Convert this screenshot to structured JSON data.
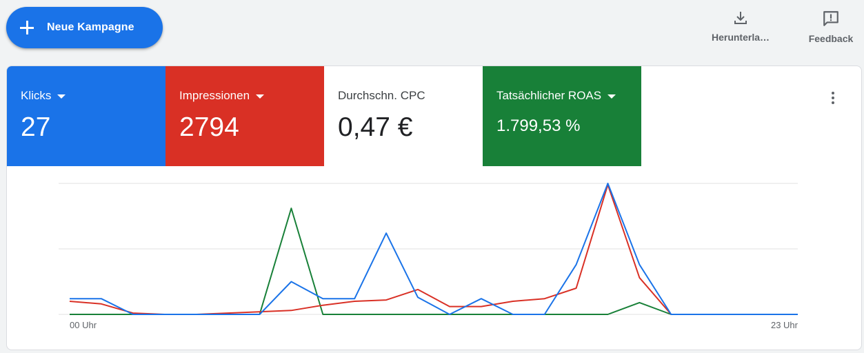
{
  "toolbar": {
    "new_campaign_label": "Neue Kampagne",
    "download_label": "Herunterla…",
    "feedback_label": "Feedback"
  },
  "metrics": [
    {
      "name": "Klicks",
      "value": "27",
      "has_dropdown": true,
      "color": "#1a73e8"
    },
    {
      "name": "Impressionen",
      "value": "2794",
      "has_dropdown": true,
      "color": "#d93025"
    },
    {
      "name": "Durchschn. CPC",
      "value": "0,47 €",
      "has_dropdown": false,
      "color": "#ffffff"
    },
    {
      "name": "Tatsächlicher ROAS",
      "value": "1.799,53 %",
      "has_dropdown": true,
      "color": "#188038"
    }
  ],
  "icons": {
    "new_campaign": "plus-icon",
    "download": "download-icon",
    "feedback": "feedback-icon",
    "more": "more-vert-icon"
  },
  "chart_data": {
    "type": "line",
    "x": [
      0,
      1,
      2,
      3,
      4,
      5,
      6,
      7,
      8,
      9,
      10,
      11,
      12,
      13,
      14,
      15,
      16,
      17,
      18,
      19,
      20,
      21,
      22,
      23
    ],
    "x_tick_labels": [
      "00 Uhr",
      "23 Uhr"
    ],
    "grid": true,
    "y_max_normalized": 1.0,
    "series": [
      {
        "key": "klicks",
        "color": "#1a73e8",
        "values": [
          0.12,
          0.12,
          0.0,
          0.0,
          0.0,
          0.0,
          0.0,
          0.25,
          0.12,
          0.12,
          0.62,
          0.13,
          0.0,
          0.12,
          0.0,
          0.0,
          0.38,
          1.0,
          0.38,
          0.0,
          0.0,
          0.0,
          0.0,
          0.0
        ]
      },
      {
        "key": "impressionen",
        "color": "#d93025",
        "values": [
          0.1,
          0.08,
          0.01,
          0.0,
          0.0,
          0.01,
          0.02,
          0.03,
          0.07,
          0.1,
          0.11,
          0.19,
          0.06,
          0.06,
          0.1,
          0.12,
          0.2,
          0.99,
          0.28,
          0.0,
          0.0,
          0.0,
          0.0,
          0.0
        ]
      },
      {
        "key": "roas",
        "color": "#188038",
        "values": [
          0.0,
          0.0,
          0.0,
          0.0,
          0.0,
          0.0,
          0.0,
          0.81,
          0.0,
          0.0,
          0.0,
          0.0,
          0.0,
          0.0,
          0.0,
          0.0,
          0.0,
          0.0,
          0.09,
          0.0,
          0.0,
          0.0,
          0.0,
          0.0
        ]
      }
    ]
  }
}
